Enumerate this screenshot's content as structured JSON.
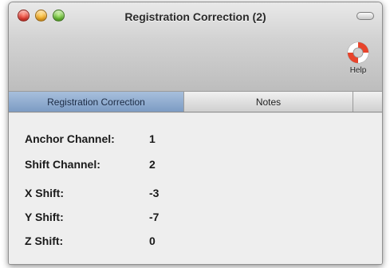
{
  "window": {
    "title": "Registration Correction (2)"
  },
  "toolbar": {
    "help_label": "Help",
    "help_icon": "lifebuoy-icon"
  },
  "tabs": [
    {
      "label": "Registration Correction",
      "selected": true
    },
    {
      "label": "Notes",
      "selected": false
    }
  ],
  "fields": [
    {
      "label": "Anchor Channel:",
      "value": "1"
    },
    {
      "label": "Shift Channel:",
      "value": "2"
    },
    {
      "label": "X Shift:",
      "value": "-3"
    },
    {
      "label": "Y Shift:",
      "value": "-7"
    },
    {
      "label": "Z Shift:",
      "value": "0"
    }
  ],
  "colors": {
    "close": "#e0362b",
    "minimize": "#f2a81d",
    "zoom": "#63bb2d",
    "selected_tab": "#8faccf",
    "help_icon_red": "#e8442b"
  }
}
